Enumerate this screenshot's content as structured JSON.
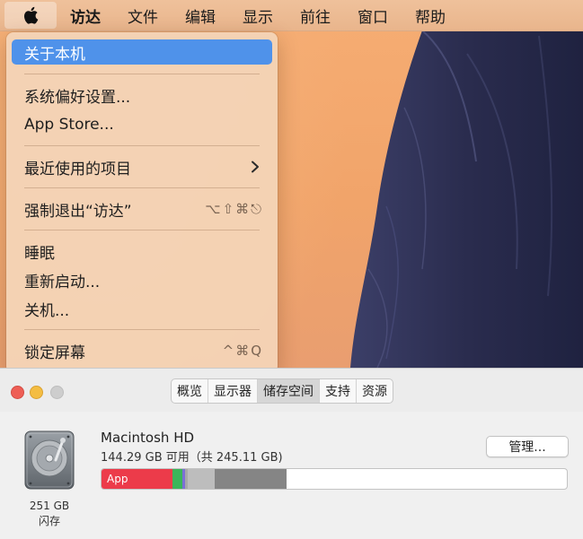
{
  "menubar": {
    "app_name": "访达",
    "items": [
      "文件",
      "编辑",
      "显示",
      "前往",
      "窗口",
      "帮助"
    ]
  },
  "apple_menu": {
    "about": "关于本机",
    "preferences": "系统偏好设置...",
    "app_store": "App Store...",
    "recent_items": "最近使用的项目",
    "force_quit": "强制退出“访达”",
    "force_quit_shortcut": "⌥⇧⌘⎋",
    "sleep": "睡眠",
    "restart": "重新启动...",
    "shutdown": "关机...",
    "lock_screen": "锁定屏幕",
    "lock_shortcut": "^⌘Q"
  },
  "about_window": {
    "tabs": [
      "概览",
      "显示器",
      "储存空间",
      "支持",
      "资源"
    ],
    "active_tab": "储存空间",
    "disk": {
      "size": "251 GB",
      "type": "闪存",
      "name": "Macintosh HD",
      "available": "144.29 GB 可用（共 245.11 GB)"
    },
    "manage_label": "管理...",
    "storage_segments": [
      {
        "label": "App",
        "color": "#ec3b4a",
        "fraction": 0.153
      },
      {
        "label": "",
        "color": "#3cb55a",
        "fraction": 0.021
      },
      {
        "label": "",
        "color": "#7c6fd6",
        "fraction": 0.006
      },
      {
        "label": "",
        "color": "#a8a8a8",
        "fraction": 0.005
      },
      {
        "label": "",
        "color": "#bdbdbd",
        "fraction": 0.057
      },
      {
        "label": "",
        "color": "#858585",
        "fraction": 0.154
      }
    ]
  }
}
